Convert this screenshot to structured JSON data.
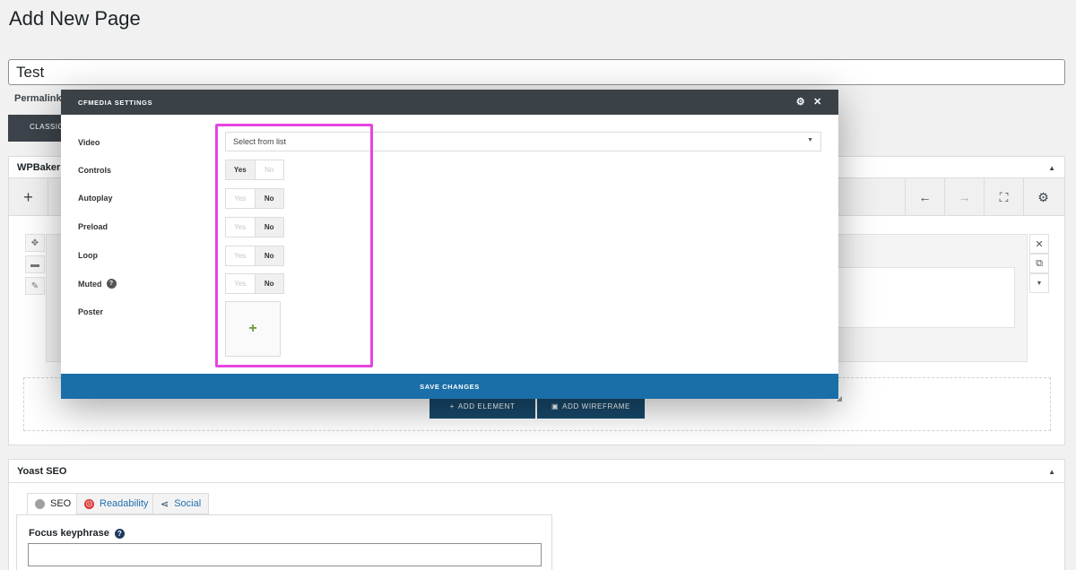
{
  "page": {
    "title": "Add New Page"
  },
  "post": {
    "title_value": "Test",
    "permalink_label": "Permalink:"
  },
  "classic": {
    "label": "CLASSIC MODE"
  },
  "wpbakery": {
    "title": "WPBaker",
    "add_element_label": "ADD ELEMENT",
    "add_wireframe_label": "ADD WIREFRAME"
  },
  "modal": {
    "title": "CFMEDIA SETTINGS",
    "save_label": "SAVE CHANGES",
    "fields": {
      "video": {
        "label": "Video",
        "select_value": "Select from list"
      },
      "controls": {
        "label": "Controls",
        "yes": "Yes",
        "no": "No",
        "value": "Yes"
      },
      "autoplay": {
        "label": "Autoplay",
        "yes": "Yes",
        "no": "No",
        "value": "No"
      },
      "preload": {
        "label": "Preload",
        "yes": "Yes",
        "no": "No",
        "value": "No"
      },
      "loop": {
        "label": "Loop",
        "yes": "Yes",
        "no": "No",
        "value": "No"
      },
      "muted": {
        "label": "Muted",
        "help": "?",
        "yes": "Yes",
        "no": "No",
        "value": "No"
      },
      "poster": {
        "label": "Poster",
        "add": "+"
      }
    }
  },
  "yoast": {
    "title": "Yoast SEO",
    "tabs": [
      {
        "label": "SEO"
      },
      {
        "label": "Readability"
      },
      {
        "label": "Social"
      }
    ],
    "focus_label": "Focus keyphrase",
    "focus_help": "?",
    "focus_value": ""
  },
  "colors": {
    "accent": "#1b6fa8",
    "highlight": "#e545e0",
    "modal_header": "#3a4248"
  }
}
